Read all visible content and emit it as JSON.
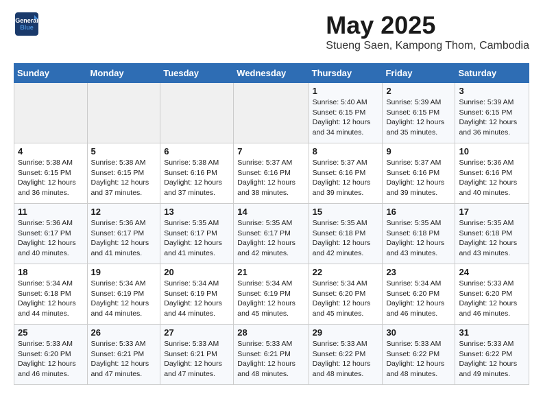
{
  "logo": {
    "line1": "General",
    "line2": "Blue"
  },
  "title": "May 2025",
  "location": "Stueng Saen, Kampong Thom, Cambodia",
  "headers": [
    "Sunday",
    "Monday",
    "Tuesday",
    "Wednesday",
    "Thursday",
    "Friday",
    "Saturday"
  ],
  "weeks": [
    [
      {
        "day": "",
        "detail": ""
      },
      {
        "day": "",
        "detail": ""
      },
      {
        "day": "",
        "detail": ""
      },
      {
        "day": "",
        "detail": ""
      },
      {
        "day": "1",
        "detail": "Sunrise: 5:40 AM\nSunset: 6:15 PM\nDaylight: 12 hours\nand 34 minutes."
      },
      {
        "day": "2",
        "detail": "Sunrise: 5:39 AM\nSunset: 6:15 PM\nDaylight: 12 hours\nand 35 minutes."
      },
      {
        "day": "3",
        "detail": "Sunrise: 5:39 AM\nSunset: 6:15 PM\nDaylight: 12 hours\nand 36 minutes."
      }
    ],
    [
      {
        "day": "4",
        "detail": "Sunrise: 5:38 AM\nSunset: 6:15 PM\nDaylight: 12 hours\nand 36 minutes."
      },
      {
        "day": "5",
        "detail": "Sunrise: 5:38 AM\nSunset: 6:15 PM\nDaylight: 12 hours\nand 37 minutes."
      },
      {
        "day": "6",
        "detail": "Sunrise: 5:38 AM\nSunset: 6:16 PM\nDaylight: 12 hours\nand 37 minutes."
      },
      {
        "day": "7",
        "detail": "Sunrise: 5:37 AM\nSunset: 6:16 PM\nDaylight: 12 hours\nand 38 minutes."
      },
      {
        "day": "8",
        "detail": "Sunrise: 5:37 AM\nSunset: 6:16 PM\nDaylight: 12 hours\nand 39 minutes."
      },
      {
        "day": "9",
        "detail": "Sunrise: 5:37 AM\nSunset: 6:16 PM\nDaylight: 12 hours\nand 39 minutes."
      },
      {
        "day": "10",
        "detail": "Sunrise: 5:36 AM\nSunset: 6:16 PM\nDaylight: 12 hours\nand 40 minutes."
      }
    ],
    [
      {
        "day": "11",
        "detail": "Sunrise: 5:36 AM\nSunset: 6:17 PM\nDaylight: 12 hours\nand 40 minutes."
      },
      {
        "day": "12",
        "detail": "Sunrise: 5:36 AM\nSunset: 6:17 PM\nDaylight: 12 hours\nand 41 minutes."
      },
      {
        "day": "13",
        "detail": "Sunrise: 5:35 AM\nSunset: 6:17 PM\nDaylight: 12 hours\nand 41 minutes."
      },
      {
        "day": "14",
        "detail": "Sunrise: 5:35 AM\nSunset: 6:17 PM\nDaylight: 12 hours\nand 42 minutes."
      },
      {
        "day": "15",
        "detail": "Sunrise: 5:35 AM\nSunset: 6:18 PM\nDaylight: 12 hours\nand 42 minutes."
      },
      {
        "day": "16",
        "detail": "Sunrise: 5:35 AM\nSunset: 6:18 PM\nDaylight: 12 hours\nand 43 minutes."
      },
      {
        "day": "17",
        "detail": "Sunrise: 5:35 AM\nSunset: 6:18 PM\nDaylight: 12 hours\nand 43 minutes."
      }
    ],
    [
      {
        "day": "18",
        "detail": "Sunrise: 5:34 AM\nSunset: 6:18 PM\nDaylight: 12 hours\nand 44 minutes."
      },
      {
        "day": "19",
        "detail": "Sunrise: 5:34 AM\nSunset: 6:19 PM\nDaylight: 12 hours\nand 44 minutes."
      },
      {
        "day": "20",
        "detail": "Sunrise: 5:34 AM\nSunset: 6:19 PM\nDaylight: 12 hours\nand 44 minutes."
      },
      {
        "day": "21",
        "detail": "Sunrise: 5:34 AM\nSunset: 6:19 PM\nDaylight: 12 hours\nand 45 minutes."
      },
      {
        "day": "22",
        "detail": "Sunrise: 5:34 AM\nSunset: 6:20 PM\nDaylight: 12 hours\nand 45 minutes."
      },
      {
        "day": "23",
        "detail": "Sunrise: 5:34 AM\nSunset: 6:20 PM\nDaylight: 12 hours\nand 46 minutes."
      },
      {
        "day": "24",
        "detail": "Sunrise: 5:33 AM\nSunset: 6:20 PM\nDaylight: 12 hours\nand 46 minutes."
      }
    ],
    [
      {
        "day": "25",
        "detail": "Sunrise: 5:33 AM\nSunset: 6:20 PM\nDaylight: 12 hours\nand 46 minutes."
      },
      {
        "day": "26",
        "detail": "Sunrise: 5:33 AM\nSunset: 6:21 PM\nDaylight: 12 hours\nand 47 minutes."
      },
      {
        "day": "27",
        "detail": "Sunrise: 5:33 AM\nSunset: 6:21 PM\nDaylight: 12 hours\nand 47 minutes."
      },
      {
        "day": "28",
        "detail": "Sunrise: 5:33 AM\nSunset: 6:21 PM\nDaylight: 12 hours\nand 48 minutes."
      },
      {
        "day": "29",
        "detail": "Sunrise: 5:33 AM\nSunset: 6:22 PM\nDaylight: 12 hours\nand 48 minutes."
      },
      {
        "day": "30",
        "detail": "Sunrise: 5:33 AM\nSunset: 6:22 PM\nDaylight: 12 hours\nand 48 minutes."
      },
      {
        "day": "31",
        "detail": "Sunrise: 5:33 AM\nSunset: 6:22 PM\nDaylight: 12 hours\nand 49 minutes."
      }
    ]
  ]
}
